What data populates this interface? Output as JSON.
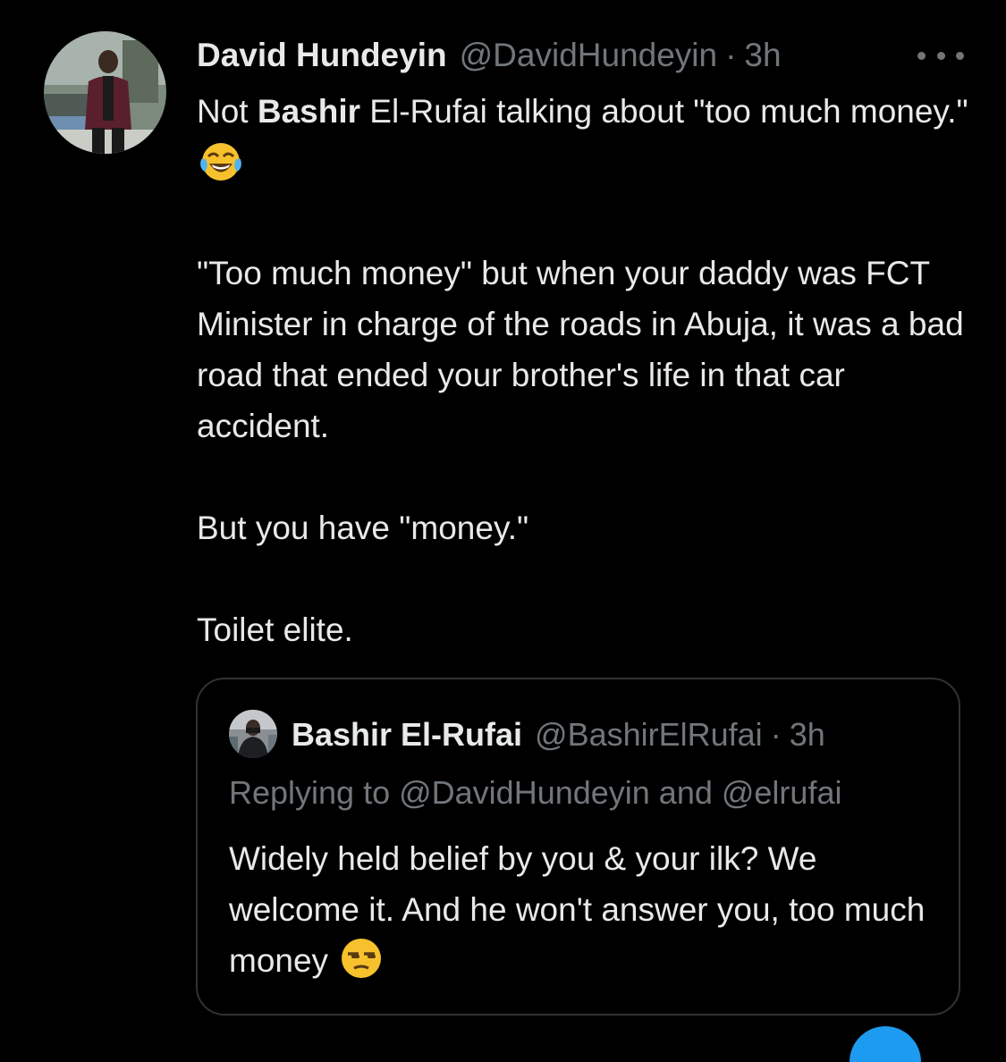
{
  "tweet": {
    "author_name": "David Hundeyin",
    "author_handle": "@DavidHundeyin",
    "separator": "·",
    "time": "3h",
    "text": {
      "line1_prefix": "Not ",
      "line1_bold": "Bashir",
      "line1_suffix": " El-Rufai talking about \"too much money.\"",
      "emoji": "face-with-tears-of-joy",
      "para2": "\"Too much money\" but when your daddy was FCT Minister in charge of the roads in Abuja, it was a bad road that ended your brother's life in that car accident.",
      "para3": "But you have \"money.\"",
      "para4": "Toilet elite."
    },
    "more_icon": "more-dots-icon"
  },
  "quoted_tweet": {
    "author_name": "Bashir El-Rufai",
    "author_handle": "@BashirElRufai",
    "separator": "·",
    "time": "3h",
    "replying_to": "Replying to @DavidHundeyin and @elrufai",
    "text": "Widely held belief by you & your ilk? We welcome it. And he won't answer you, too much money",
    "emoji": "unamused-face"
  },
  "colors": {
    "background": "#000000",
    "text_primary": "#e7e9ea",
    "text_secondary": "#71767b",
    "border": "#2f3336",
    "accent": "#1d9bf0"
  }
}
